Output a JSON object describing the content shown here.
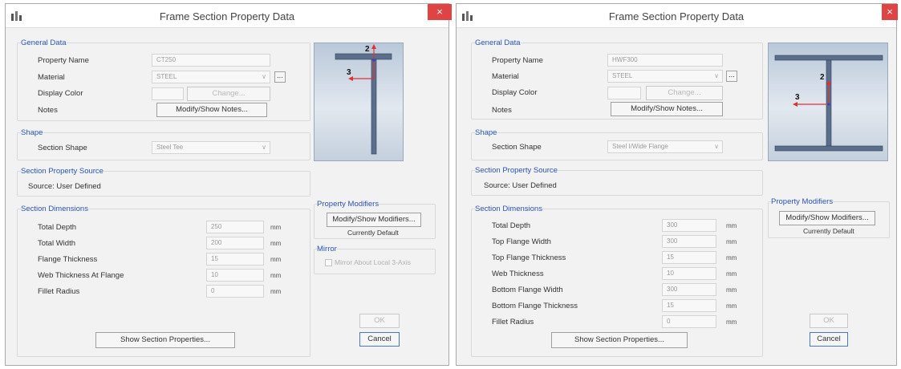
{
  "left": {
    "title": "Frame Section Property Data",
    "general_data_label": "General Data",
    "property_name_label": "Property Name",
    "property_name_value": "CT250",
    "material_label": "Material",
    "material_value": "STEEL",
    "material_more": "...",
    "display_color_label": "Display Color",
    "change_label": "Change...",
    "notes_label": "Notes",
    "notes_button": "Modify/Show Notes...",
    "shape_label": "Shape",
    "section_shape_label": "Section Shape",
    "section_shape_value": "Steel Tee",
    "property_source_label": "Section Property Source",
    "source_text": "Source:  User Defined",
    "dimensions_label": "Section Dimensions",
    "dimensions": [
      {
        "label": "Total Depth",
        "value": "250",
        "unit": "mm"
      },
      {
        "label": "Total Width",
        "value": "200",
        "unit": "mm"
      },
      {
        "label": "Flange Thickness",
        "value": "15",
        "unit": "mm"
      },
      {
        "label": "Web Thickness At Flange",
        "value": "10",
        "unit": "mm"
      },
      {
        "label": "Fillet Radius",
        "value": "0",
        "unit": "mm"
      }
    ],
    "axis_2": "2",
    "axis_3": "3",
    "property_modifiers_label": "Property Modifiers",
    "modifiers_button": "Modify/Show Modifiers...",
    "currently_default": "Currently Default",
    "mirror_label": "Mirror",
    "mirror_check_label": "Mirror About Local 3-Axis",
    "show_props_button": "Show Section Properties...",
    "ok_button": "OK",
    "cancel_button": "Cancel",
    "close": "×"
  },
  "right": {
    "title": "Frame Section Property Data",
    "general_data_label": "General Data",
    "property_name_label": "Property Name",
    "property_name_value": "HWF300",
    "material_label": "Material",
    "material_value": "STEEL",
    "material_more": "...",
    "display_color_label": "Display Color",
    "change_label": "Change...",
    "notes_label": "Notes",
    "notes_button": "Modify/Show Notes...",
    "shape_label": "Shape",
    "section_shape_label": "Section Shape",
    "section_shape_value": "Steel I/Wide Flange",
    "property_source_label": "Section Property Source",
    "source_text": "Source:  User Defined",
    "dimensions_label": "Section Dimensions",
    "dimensions": [
      {
        "label": "Total Depth",
        "value": "300",
        "unit": "mm"
      },
      {
        "label": "Top Flange Width",
        "value": "300",
        "unit": "mm"
      },
      {
        "label": "Top Flange Thickness",
        "value": "15",
        "unit": "mm"
      },
      {
        "label": "Web Thickness",
        "value": "10",
        "unit": "mm"
      },
      {
        "label": "Bottom Flange Width",
        "value": "300",
        "unit": "mm"
      },
      {
        "label": "Bottom Flange Thickness",
        "value": "15",
        "unit": "mm"
      },
      {
        "label": "Fillet Radius",
        "value": "0",
        "unit": "mm"
      }
    ],
    "axis_2": "2",
    "axis_3": "3",
    "property_modifiers_label": "Property Modifiers",
    "modifiers_button": "Modify/Show Modifiers...",
    "currently_default": "Currently Default",
    "show_props_button": "Show Section Properties...",
    "ok_button": "OK",
    "cancel_button": "Cancel",
    "close": "×"
  }
}
